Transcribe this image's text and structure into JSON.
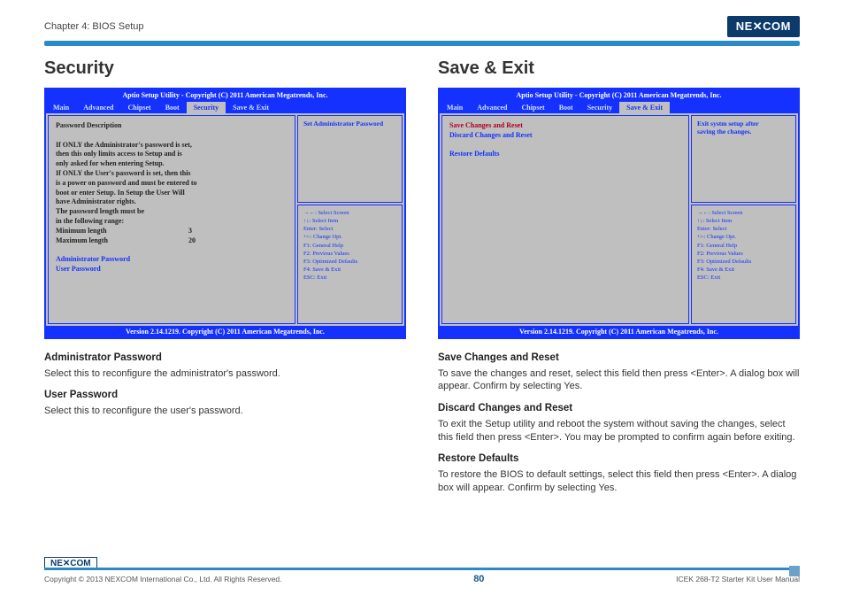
{
  "header": {
    "chapter": "Chapter 4: BIOS Setup",
    "logo": "NE✕COM"
  },
  "footer": {
    "logo": "NE✕COM",
    "copyright": "Copyright © 2013 NEXCOM International Co., Ltd. All Rights Reserved.",
    "page_num": "80",
    "manual": "ICEK 268-T2 Starter Kit User Manual"
  },
  "bios_common": {
    "title": "Aptio Setup Utility - Copyright (C) 2011 American Megatrends, Inc.",
    "version": "Version 2.14.1219. Copyright (C) 2011 American Megatrends, Inc.",
    "tabs": [
      "Main",
      "Advanced",
      "Chipset",
      "Boot",
      "Security",
      "Save & Exit"
    ],
    "help": {
      "l1": "→←: Select Screen",
      "l2": "↑↓: Select Item",
      "l3": "Enter: Select",
      "l4": "+/-: Change Opt.",
      "l5": "F1: General Help",
      "l6": "F2: Previous Values",
      "l7": "F3: Optimized Defaults",
      "l8": "F4: Save & Exit",
      "l9": "ESC: Exit"
    }
  },
  "left": {
    "heading": "Security",
    "bios": {
      "active_tab": "Security",
      "right_hint": "Set Administrator Password",
      "body": {
        "t1": "Password Description",
        "t2": "If ONLY the Administrator's password is set,",
        "t3": "then this only limits access to Setup and is",
        "t4": "only asked for when entering Setup.",
        "t5": "If ONLY the User's password is set, then this",
        "t6": "is a power on password and must be entered to",
        "t7": "boot or enter Setup. In Setup the User Will",
        "t8": "have Administrator rights.",
        "t9": "The password length must be",
        "t10": "in the following range:",
        "min_label": "Minimum length",
        "min_val": "3",
        "max_label": "Maximum length",
        "max_val": "20",
        "admin": "Administrator Password",
        "user": "User Password"
      }
    },
    "desc": {
      "h1": "Administrator Password",
      "p1": "Select this to reconfigure the administrator's password.",
      "h2": "User Password",
      "p2": "Select this to reconfigure the user's password."
    }
  },
  "right": {
    "heading": "Save & Exit",
    "bios": {
      "active_tab": "Save & Exit",
      "right_hint1": "Exit systm setup after",
      "right_hint2": "saving the changes.",
      "body": {
        "i1": "Save Changes and Reset",
        "i2": "Discard Changes and Reset",
        "i3": "Restore Defaults"
      }
    },
    "desc": {
      "h1": "Save Changes and Reset",
      "p1": "To save the changes and reset, select this field then press <Enter>. A dialog box will appear. Confirm by selecting Yes.",
      "h2": "Discard Changes and Reset",
      "p2": "To exit the Setup utility and reboot the system without saving the changes, select this field then press <Enter>. You may be prompted to confirm again before exiting.",
      "h3": "Restore Defaults",
      "p3": "To restore the BIOS to default settings, select this field then press <Enter>. A dialog box will appear. Confirm by selecting Yes."
    }
  }
}
